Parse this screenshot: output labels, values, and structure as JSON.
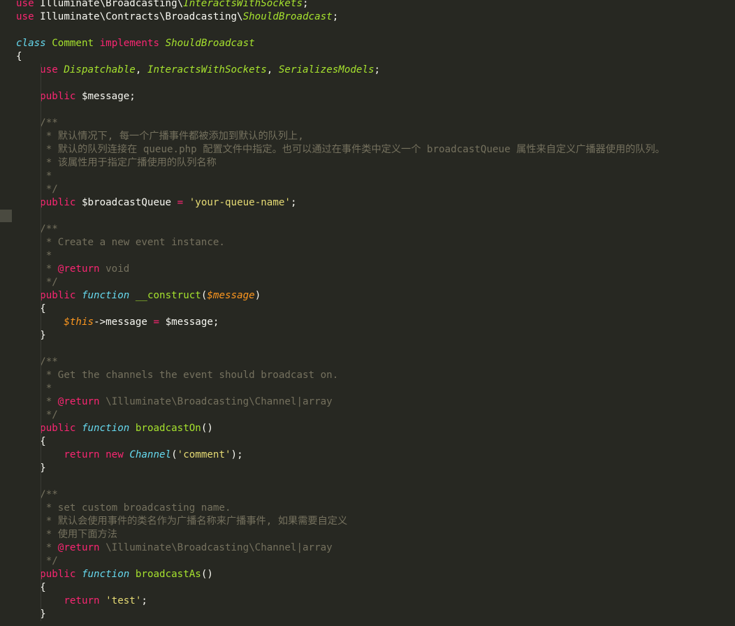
{
  "editor": {
    "theme_colors": {
      "background": "#272822",
      "keyword": "#f92672",
      "storage": "#66d9ef",
      "class_name": "#a6e22e",
      "comment": "#75715e",
      "string": "#e6db74",
      "variable": "#fd971f",
      "text": "#f8f8f2"
    },
    "lines": [
      [
        [
          "kw",
          "use"
        ],
        [
          "plain",
          " Illuminate\\Broadcasting\\"
        ],
        [
          "clsi",
          "InteractsWithSockets"
        ],
        [
          "plain",
          ";"
        ]
      ],
      [
        [
          "kw",
          "use"
        ],
        [
          "plain",
          " Illuminate\\Contracts\\Broadcasting\\"
        ],
        [
          "clsi",
          "ShouldBroadcast"
        ],
        [
          "plain",
          ";"
        ]
      ],
      [],
      [
        [
          "sto",
          "class"
        ],
        [
          "plain",
          " "
        ],
        [
          "cls",
          "Comment"
        ],
        [
          "plain",
          " "
        ],
        [
          "kw",
          "implements"
        ],
        [
          "plain",
          " "
        ],
        [
          "clsi",
          "ShouldBroadcast"
        ]
      ],
      [
        [
          "plain",
          "{"
        ]
      ],
      [
        [
          "plain",
          "    "
        ],
        [
          "kw",
          "use"
        ],
        [
          "plain",
          " "
        ],
        [
          "clsi",
          "Dispatchable"
        ],
        [
          "plain",
          ", "
        ],
        [
          "clsi",
          "InteractsWithSockets"
        ],
        [
          "plain",
          ", "
        ],
        [
          "clsi",
          "SerializesModels"
        ],
        [
          "plain",
          ";"
        ]
      ],
      [],
      [
        [
          "plain",
          "    "
        ],
        [
          "kw",
          "public"
        ],
        [
          "plain",
          " $message;"
        ]
      ],
      [],
      [
        [
          "plain",
          "    "
        ],
        [
          "cmt",
          "/**"
        ]
      ],
      [
        [
          "plain",
          "    "
        ],
        [
          "cmt",
          " * 默认情况下, 每一个广播事件都被添加到默认的队列上,"
        ]
      ],
      [
        [
          "plain",
          "    "
        ],
        [
          "cmt",
          " * 默认的队列连接在 queue.php 配置文件中指定。也可以通过在事件类中定义一个 broadcastQueue 属性来自定义广播器使用的队列。"
        ]
      ],
      [
        [
          "plain",
          "    "
        ],
        [
          "cmt",
          " * 该属性用于指定广播使用的队列名称"
        ]
      ],
      [
        [
          "plain",
          "    "
        ],
        [
          "cmt",
          " *"
        ]
      ],
      [
        [
          "plain",
          "    "
        ],
        [
          "cmt",
          " */"
        ]
      ],
      [
        [
          "plain",
          "    "
        ],
        [
          "kw",
          "public"
        ],
        [
          "plain",
          " $broadcastQueue "
        ],
        [
          "kw",
          "="
        ],
        [
          "plain",
          " "
        ],
        [
          "str",
          "'your-queue-name'"
        ],
        [
          "plain",
          ";"
        ]
      ],
      [],
      [
        [
          "plain",
          "    "
        ],
        [
          "cmt",
          "/**"
        ]
      ],
      [
        [
          "plain",
          "    "
        ],
        [
          "cmt",
          " * Create a new event instance."
        ]
      ],
      [
        [
          "plain",
          "    "
        ],
        [
          "cmt",
          " *"
        ]
      ],
      [
        [
          "plain",
          "    "
        ],
        [
          "cmt",
          " * "
        ],
        [
          "cmtkw",
          "@return"
        ],
        [
          "cmt",
          " void"
        ]
      ],
      [
        [
          "plain",
          "    "
        ],
        [
          "cmt",
          " */"
        ]
      ],
      [
        [
          "plain",
          "    "
        ],
        [
          "kw",
          "public"
        ],
        [
          "plain",
          " "
        ],
        [
          "sto",
          "function"
        ],
        [
          "plain",
          " "
        ],
        [
          "fn",
          "__construct"
        ],
        [
          "plain",
          "("
        ],
        [
          "var",
          "$message"
        ],
        [
          "plain",
          ")"
        ]
      ],
      [
        [
          "plain",
          "    {"
        ]
      ],
      [
        [
          "plain",
          "        "
        ],
        [
          "var",
          "$this"
        ],
        [
          "plain",
          "->message "
        ],
        [
          "kw",
          "="
        ],
        [
          "plain",
          " $message;"
        ]
      ],
      [
        [
          "plain",
          "    }"
        ]
      ],
      [],
      [
        [
          "plain",
          "    "
        ],
        [
          "cmt",
          "/**"
        ]
      ],
      [
        [
          "plain",
          "    "
        ],
        [
          "cmt",
          " * Get the channels the event should broadcast on."
        ]
      ],
      [
        [
          "plain",
          "    "
        ],
        [
          "cmt",
          " *"
        ]
      ],
      [
        [
          "plain",
          "    "
        ],
        [
          "cmt",
          " * "
        ],
        [
          "cmtkw",
          "@return"
        ],
        [
          "cmt",
          " \\Illuminate\\Broadcasting\\Channel|array"
        ]
      ],
      [
        [
          "plain",
          "    "
        ],
        [
          "cmt",
          " */"
        ]
      ],
      [
        [
          "plain",
          "    "
        ],
        [
          "kw",
          "public"
        ],
        [
          "plain",
          " "
        ],
        [
          "sto",
          "function"
        ],
        [
          "plain",
          " "
        ],
        [
          "fn",
          "broadcastOn"
        ],
        [
          "plain",
          "()"
        ]
      ],
      [
        [
          "plain",
          "    {"
        ]
      ],
      [
        [
          "plain",
          "        "
        ],
        [
          "kw",
          "return"
        ],
        [
          "plain",
          " "
        ],
        [
          "kw",
          "new"
        ],
        [
          "plain",
          " "
        ],
        [
          "typi",
          "Channel"
        ],
        [
          "plain",
          "("
        ],
        [
          "str",
          "'comment'"
        ],
        [
          "plain",
          ");"
        ]
      ],
      [
        [
          "plain",
          "    }"
        ]
      ],
      [],
      [
        [
          "plain",
          "    "
        ],
        [
          "cmt",
          "/**"
        ]
      ],
      [
        [
          "plain",
          "    "
        ],
        [
          "cmt",
          " * set custom broadcasting name."
        ]
      ],
      [
        [
          "plain",
          "    "
        ],
        [
          "cmt",
          " * 默认会使用事件的类名作为广播名称来广播事件, 如果需要自定义"
        ]
      ],
      [
        [
          "plain",
          "    "
        ],
        [
          "cmt",
          " * 使用下面方法"
        ]
      ],
      [
        [
          "plain",
          "    "
        ],
        [
          "cmt",
          " * "
        ],
        [
          "cmtkw",
          "@return"
        ],
        [
          "cmt",
          " \\Illuminate\\Broadcasting\\Channel|array"
        ]
      ],
      [
        [
          "plain",
          "    "
        ],
        [
          "cmt",
          " */"
        ]
      ],
      [
        [
          "plain",
          "    "
        ],
        [
          "kw",
          "public"
        ],
        [
          "plain",
          " "
        ],
        [
          "sto",
          "function"
        ],
        [
          "plain",
          " "
        ],
        [
          "fn",
          "broadcastAs"
        ],
        [
          "plain",
          "()"
        ]
      ],
      [
        [
          "plain",
          "    {"
        ]
      ],
      [
        [
          "plain",
          "        "
        ],
        [
          "kw",
          "return"
        ],
        [
          "plain",
          " "
        ],
        [
          "str",
          "'test'"
        ],
        [
          "plain",
          ";"
        ]
      ],
      [
        [
          "plain",
          "    }"
        ]
      ]
    ]
  }
}
